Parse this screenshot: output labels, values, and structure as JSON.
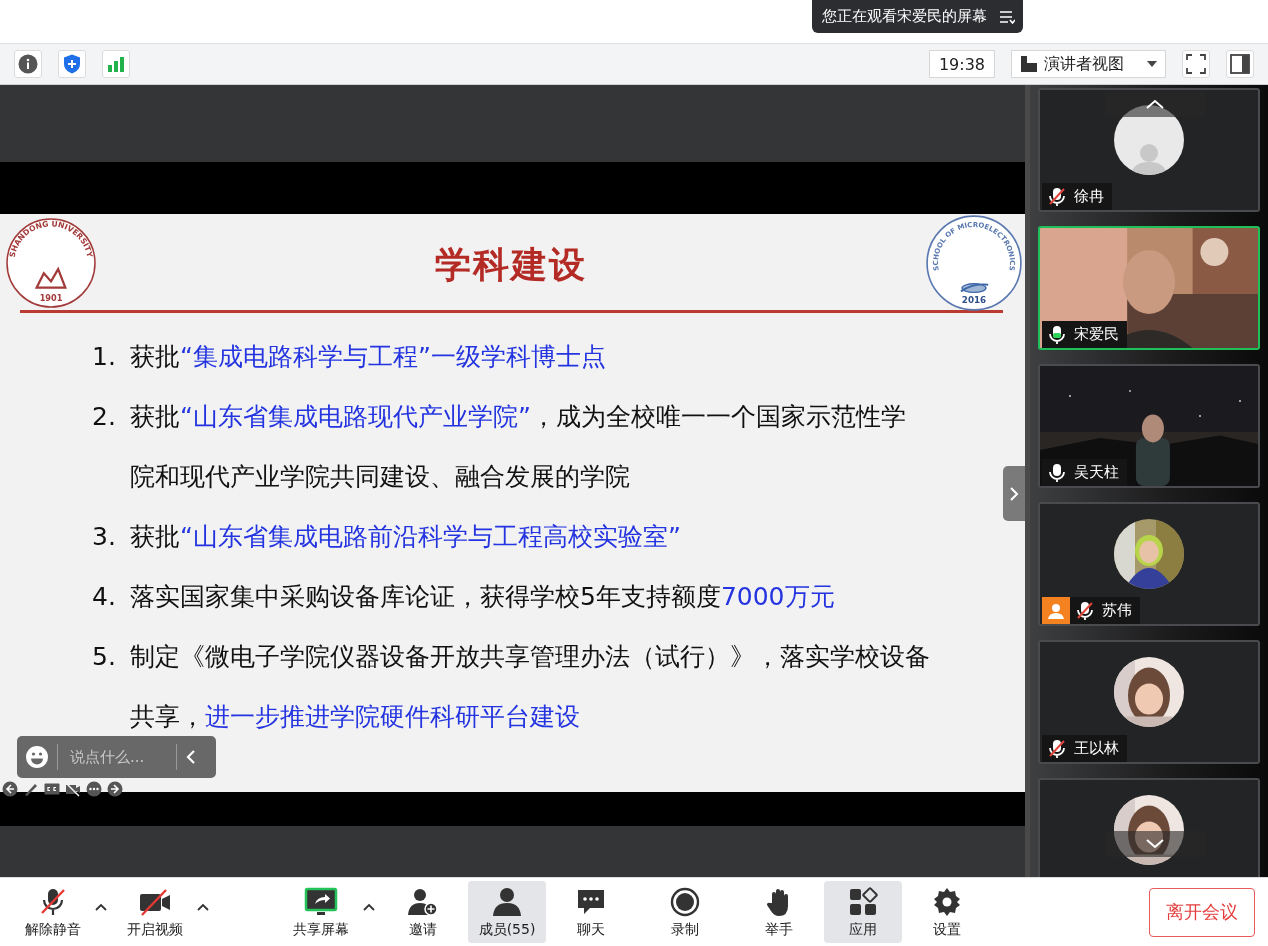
{
  "screen_share_notice": {
    "text": "您正在观看宋爱民的屏幕"
  },
  "toolbar": {
    "time": "19:38",
    "view_mode": "演讲者视图"
  },
  "slide": {
    "title": "学科建设",
    "left_logo": {
      "caption": "SHANDONG UNIVERSITY",
      "year": "1901"
    },
    "right_logo": {
      "caption": "SCHOOL OF MICROELECTRONICS",
      "year": "2016"
    },
    "items": [
      {
        "number": "1.",
        "segments": [
          {
            "text": "获批",
            "highlight": false
          },
          {
            "text": "“集成电路科学与工程”一级学科博士点",
            "highlight": true
          }
        ]
      },
      {
        "number": "2.",
        "segments": [
          {
            "text": "获批",
            "highlight": false
          },
          {
            "text": "“山东省集成电路现代产业学院”",
            "highlight": true
          },
          {
            "text": "，成为全校唯一一个国家示范性学院和现代产业学院共同建设、融合发展的学院",
            "highlight": false
          }
        ]
      },
      {
        "number": "3.",
        "segments": [
          {
            "text": "获批",
            "highlight": false
          },
          {
            "text": "“山东省集成电路前沿科学与工程高校实验室”",
            "highlight": true
          }
        ]
      },
      {
        "number": "4.",
        "segments": [
          {
            "text": "落实国家集中采购设备库论证，获得学校5年支持额度",
            "highlight": false
          },
          {
            "text": "7000万元",
            "highlight": true
          }
        ]
      },
      {
        "number": "5.",
        "segments": [
          {
            "text": "制定《微电子学院仪器设备开放共享管理办法（试行）》，落实学校设备共享，",
            "highlight": false
          },
          {
            "text": "进一步推进学院硬件科研平台建设",
            "highlight": true
          }
        ]
      }
    ]
  },
  "chat_box": {
    "placeholder": "说点什么..."
  },
  "participants": [
    {
      "name": "徐冉",
      "kind": "default-avatar",
      "muted": true,
      "speaking": false,
      "badge": false
    },
    {
      "name": "宋爱民",
      "kind": "video",
      "muted": false,
      "speaking": true,
      "badge": false
    },
    {
      "name": "吴天柱",
      "kind": "video",
      "muted": false,
      "speaking": false,
      "badge": false
    },
    {
      "name": "苏伟",
      "kind": "photo-avatar",
      "muted": true,
      "speaking": false,
      "badge": true
    },
    {
      "name": "王以林",
      "kind": "photo-avatar",
      "muted": true,
      "speaking": false,
      "badge": false
    },
    {
      "kind": "photo-avatar",
      "speaking": false
    }
  ],
  "controls": [
    {
      "label": "解除静音",
      "kind": "mic",
      "off": true,
      "caret": true,
      "selected": false
    },
    {
      "label": "开启视频",
      "kind": "camera",
      "off": true,
      "caret": true,
      "selected": false
    },
    {
      "label": "共享屏幕",
      "kind": "share",
      "caret": true,
      "selected": false
    },
    {
      "label": "邀请",
      "kind": "invite",
      "caret": false,
      "selected": false
    },
    {
      "label": "成员(55)",
      "kind": "members",
      "caret": false,
      "selected": true
    },
    {
      "label": "聊天",
      "kind": "chat",
      "caret": false,
      "selected": false
    },
    {
      "label": "录制",
      "kind": "record",
      "caret": false,
      "selected": false
    },
    {
      "label": "举手",
      "kind": "hand",
      "caret": false,
      "selected": false
    },
    {
      "label": "应用",
      "kind": "apps",
      "caret": false,
      "selected": true
    },
    {
      "label": "设置",
      "kind": "settings",
      "caret": false,
      "selected": false
    }
  ],
  "leave_button": "离开会议"
}
